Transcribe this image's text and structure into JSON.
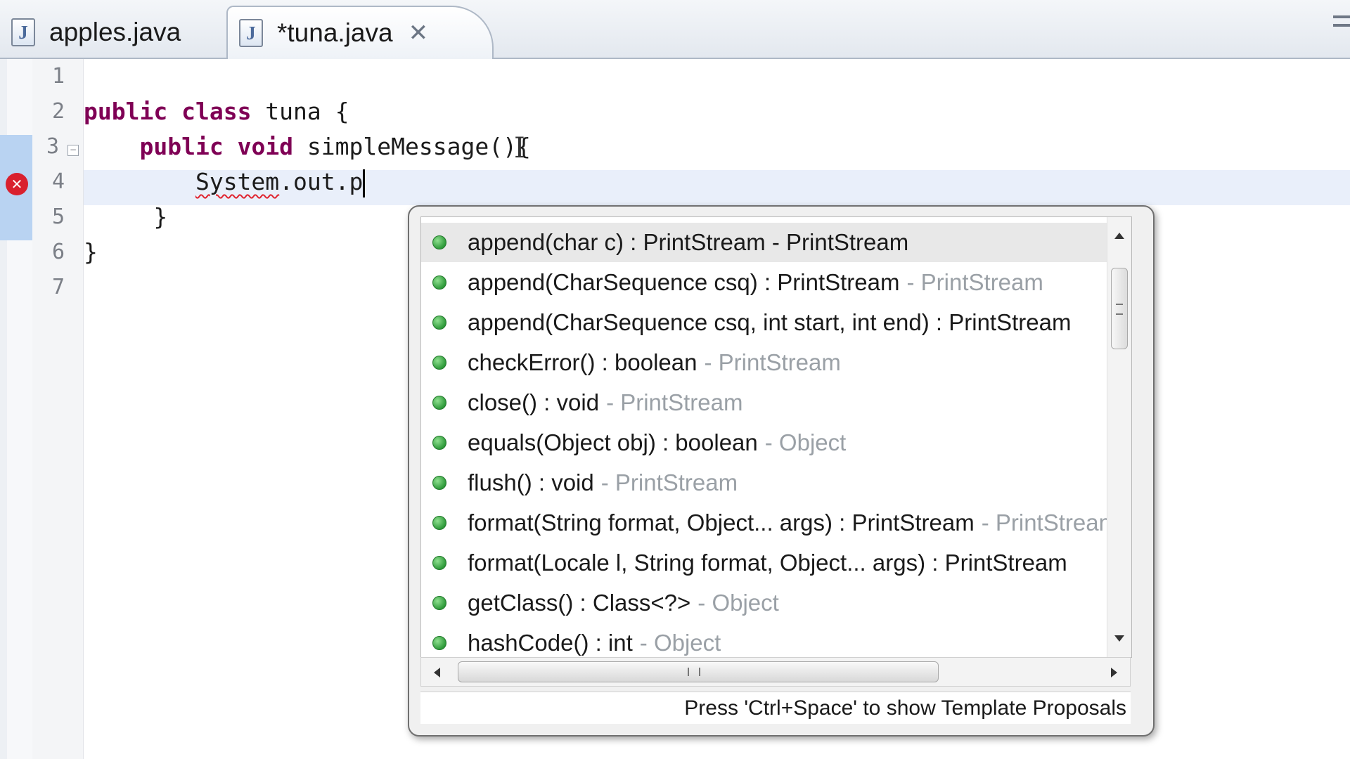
{
  "tabs": [
    {
      "label": "apples.java",
      "icon": "java-file-icon",
      "active": false
    },
    {
      "label": "*tuna.java",
      "icon": "java-file-icon",
      "active": true,
      "close": "✕"
    }
  ],
  "editor": {
    "line_numbers": [
      "1",
      "2",
      "3",
      "4",
      "5",
      "6",
      "7"
    ],
    "code": {
      "line2_kw1": "public",
      "line2_kw2": "class",
      "line2_rest": " tuna {",
      "line3_kw1": "public",
      "line3_kw2": "void",
      "line3_rest": " simpleMessage(){",
      "line4_ident": "System",
      "line4_rest": ".out.p",
      "line5": "}",
      "line6": "}"
    },
    "colors": {
      "keyword": "#7f0055",
      "error": "#d9202e",
      "current_line": "#e9effa"
    }
  },
  "content_assist": {
    "proposals": [
      {
        "text": "append(char c) : PrintStream - PrintStream",
        "qualifier": ""
      },
      {
        "text": "append(CharSequence csq) : PrintStream",
        "qualifier": "- PrintStream"
      },
      {
        "text": "append(CharSequence csq, int start, int end) : PrintStream",
        "qualifier": ""
      },
      {
        "text": "checkError() : boolean",
        "qualifier": "- PrintStream"
      },
      {
        "text": "close() : void",
        "qualifier": "- PrintStream"
      },
      {
        "text": "equals(Object obj) : boolean",
        "qualifier": "- Object"
      },
      {
        "text": "flush() : void",
        "qualifier": "- PrintStream"
      },
      {
        "text": "format(String format, Object... args) : PrintStream",
        "qualifier": "- PrintStream"
      },
      {
        "text": "format(Locale l, String format, Object... args) : PrintStream",
        "qualifier": ""
      },
      {
        "text": "getClass() : Class<?>",
        "qualifier": "- Object"
      },
      {
        "text": "hashCode() : int",
        "qualifier": "- Object"
      }
    ],
    "selected_index": 0,
    "status": "Press 'Ctrl+Space' to show Template Proposals"
  }
}
